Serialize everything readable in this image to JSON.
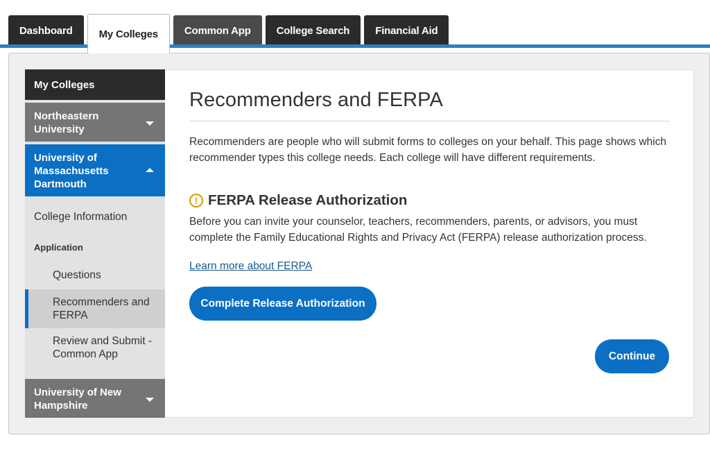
{
  "tabs": [
    {
      "label": "Dashboard"
    },
    {
      "label": "My Colleges"
    },
    {
      "label": "Common App"
    },
    {
      "label": "College Search"
    },
    {
      "label": "Financial Aid"
    }
  ],
  "sidebar": {
    "header": "My Colleges",
    "colleges": [
      {
        "name": "Northeastern University"
      },
      {
        "name": "University of Massachusetts Dartmouth"
      },
      {
        "name": "University of New Hampshire"
      }
    ],
    "college_information": "College Information",
    "application_section": "Application",
    "items": [
      {
        "label": "Questions"
      },
      {
        "label": "Recommenders and FERPA"
      },
      {
        "label": "Review and Submit - Common App"
      }
    ]
  },
  "main": {
    "title": "Recommenders and FERPA",
    "intro": "Recommenders are people who will submit forms to colleges on your behalf. This page shows which recommender types this college needs. Each college will have different requirements.",
    "ferpa_icon": "!",
    "ferpa_title": "FERPA Release Authorization",
    "ferpa_text": "Before you can invite your counselor, teachers, recommenders, parents, or advisors, you must complete the Family Educational Rights and Privacy Act (FERPA) release authorization process.",
    "learn_more": "Learn more about FERPA",
    "release_button": "Complete Release Authorization",
    "continue_button": "Continue"
  },
  "colors": {
    "accent": "#0b6fc4",
    "tab_dark": "#2b2b2b",
    "warning": "#d99a00"
  }
}
